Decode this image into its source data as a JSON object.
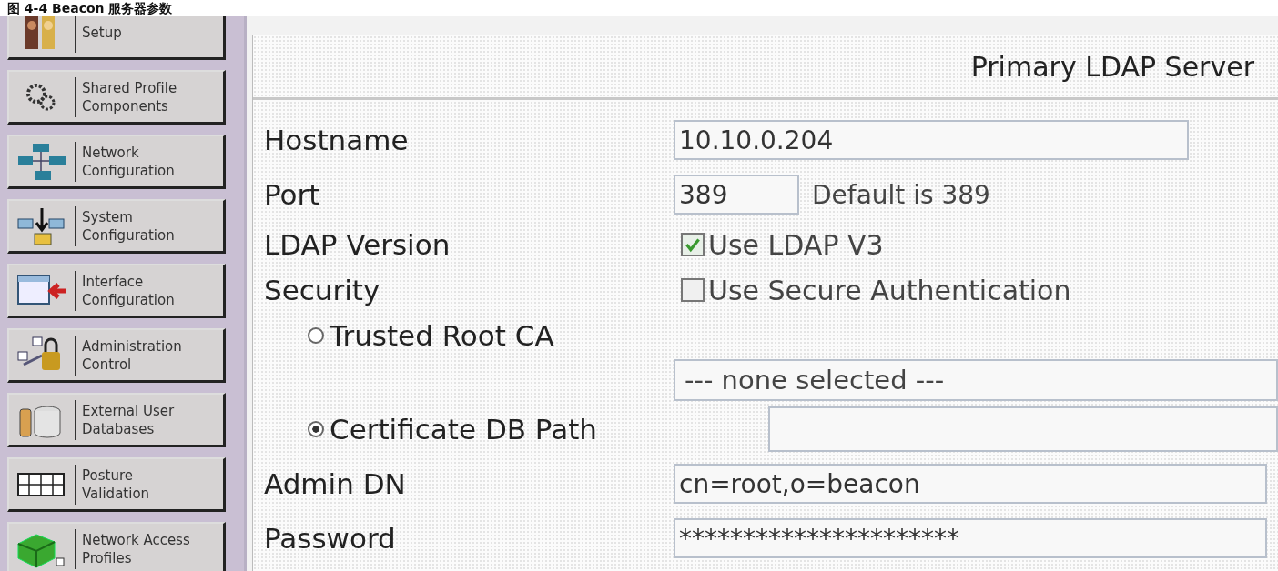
{
  "caption": "图 4-4 Beacon 服务器参数",
  "sidebar": {
    "items": [
      {
        "lines": [
          "Setup"
        ]
      },
      {
        "lines": [
          "Shared Profile",
          "Components"
        ]
      },
      {
        "lines": [
          "Network",
          "Configuration"
        ]
      },
      {
        "lines": [
          "System",
          "Configuration"
        ]
      },
      {
        "lines": [
          "Interface",
          "Configuration"
        ]
      },
      {
        "lines": [
          "Administration",
          "Control"
        ]
      },
      {
        "lines": [
          "External User",
          "Databases"
        ]
      },
      {
        "lines": [
          "Posture",
          "Validation"
        ]
      },
      {
        "lines": [
          "Network Access",
          "Profiles"
        ]
      }
    ]
  },
  "panel": {
    "title": "Primary LDAP Server",
    "rows": [
      {
        "kind": "input",
        "label": "Hostname",
        "value": "10.10.0.204"
      },
      {
        "kind": "input",
        "label": "Port",
        "value": "389",
        "hint": "Default is 389"
      },
      {
        "kind": "checkbox",
        "label": "LDAP Version",
        "option": "Use LDAP V3",
        "checked": true
      },
      {
        "kind": "checkbox",
        "label": "Security",
        "option": "Use Secure Authentication",
        "checked": false
      },
      {
        "kind": "radio",
        "label": "Trusted Root CA",
        "selected": false
      },
      {
        "kind": "select",
        "value": "--- none selected ---"
      },
      {
        "kind": "radio_input",
        "label": "Certificate DB Path",
        "selected": true
      },
      {
        "kind": "input",
        "label": "Admin DN",
        "value": "cn=root,o=beacon"
      },
      {
        "kind": "input",
        "label": "Password",
        "value": "**********************"
      }
    ]
  }
}
